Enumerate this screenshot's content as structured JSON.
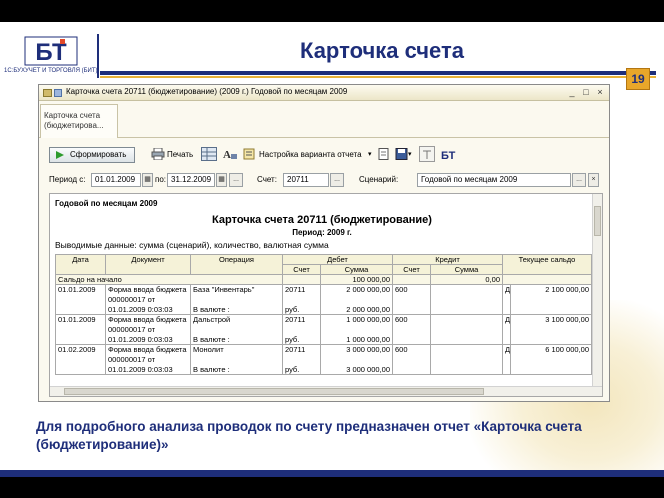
{
  "slide": {
    "title": "Карточка счета",
    "page_number": "19",
    "logo_mark": "БТ",
    "logo_text": "1С:БУХУЧЕТ И ТОРГОВЛЯ (БИТ)",
    "caption": "Для подробного анализа проводок по счету предназначен отчет «Карточка счета (бюджетирование)»",
    "colors": {
      "brand": "#1e2e7a",
      "accent": "#e8a62a"
    }
  },
  "window": {
    "title": "Карточка счета 20711 (бюджетирование) (2009 г.) Годовой по месяцам 2009",
    "minimize": "_",
    "maximize": "□",
    "close": "×",
    "tab_label": "Карточка счета (бюджетирова..."
  },
  "toolbar": {
    "generate": "Сформировать",
    "print": "Печать",
    "settings": "Настройка варианта отчета",
    "icons": [
      "play-icon",
      "printer-icon",
      "table-icon",
      "font-icon",
      "save-icon",
      "help-icon",
      "bit-logo-icon"
    ]
  },
  "filters": {
    "period_from_label": "Период с:",
    "period_from": "01.01.2009",
    "period_to_label": "по:",
    "period_to": "31.12.2009",
    "account_label": "Счет:",
    "account": "20711",
    "scenario_label": "Сценарий:",
    "scenario": "Годовой по месяцам 2009",
    "ellipsis": "...",
    "close_btn": "×"
  },
  "report": {
    "header": "Годовой по месяцам 2009",
    "title": "Карточка счета 20711 (бюджетирование)",
    "period": "Период: 2009 г.",
    "displayed": "Выводимые данные: сумма (сценарий), количество, валютная сумма",
    "columns": {
      "date": "Дата",
      "document": "Документ",
      "operation": "Операция",
      "debit": "Дебет",
      "credit": "Кредит",
      "balance": "Текущее сальдо",
      "account": "Счет",
      "sum": "Сумма"
    },
    "opening": {
      "label": "Сальдо на начало",
      "debit_sum": "100 000,00",
      "credit_sum": "0,00"
    },
    "rows": [
      {
        "date": "01.01.2009",
        "doc": [
          "Форма ввода бюджета",
          "000000017 от",
          "01.01.2009 0:03:03"
        ],
        "op": [
          "База \"Инвентарь\"",
          "",
          "В валюте :"
        ],
        "debit_acc": [
          "20711",
          "",
          "руб."
        ],
        "debit_sum": [
          "2 000 000,00",
          "",
          "2 000 000,00"
        ],
        "credit_acc": "600",
        "bal_side": "Д",
        "bal_sum": "2 100 000,00"
      },
      {
        "date": "01.01.2009",
        "doc": [
          "Форма ввода бюджета",
          "000000017 от",
          "01.01.2009 0:03:03"
        ],
        "op": [
          "Дальстрой",
          "",
          "В валюте :"
        ],
        "debit_acc": [
          "20711",
          "",
          "руб."
        ],
        "debit_sum": [
          "1 000 000,00",
          "",
          "1 000 000,00"
        ],
        "credit_acc": "600",
        "bal_side": "Д",
        "bal_sum": "3 100 000,00"
      },
      {
        "date": "01.02.2009",
        "doc": [
          "Форма ввода бюджета",
          "000000017 от",
          "01.01.2009 0:03:03"
        ],
        "op": [
          "Монолит",
          "",
          "В валюте :"
        ],
        "debit_acc": [
          "20711",
          "",
          "руб."
        ],
        "debit_sum": [
          "3 000 000,00",
          "",
          "3 000 000,00"
        ],
        "credit_acc": "600",
        "bal_side": "Д",
        "bal_sum": "6 100 000,00"
      }
    ]
  }
}
